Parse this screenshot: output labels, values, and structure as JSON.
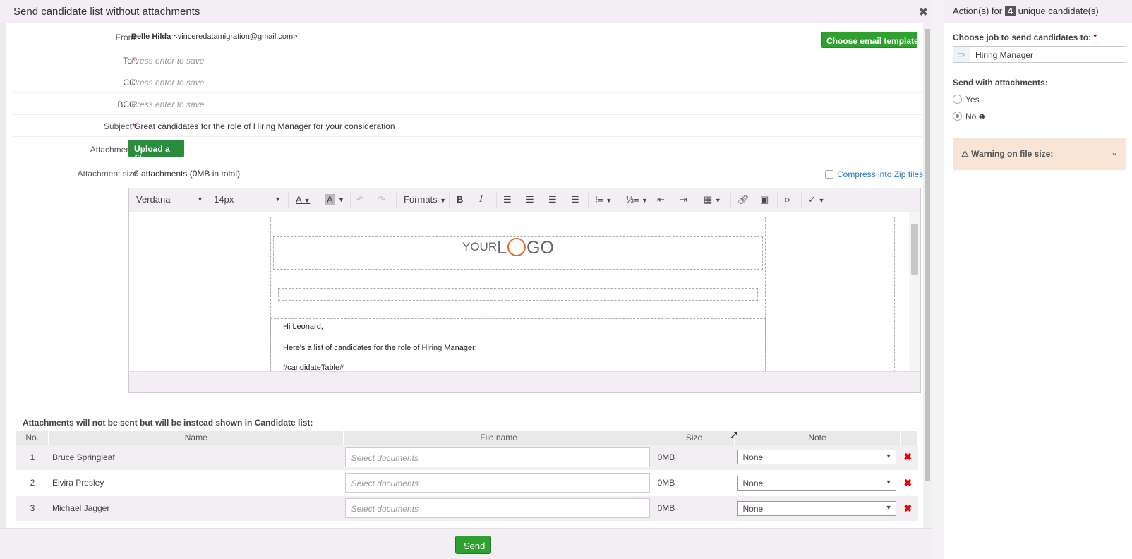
{
  "modal": {
    "title": "Send candidate list without attachments",
    "close": "✖"
  },
  "form": {
    "from_label": "From:",
    "from_name": "Belle Hilda",
    "from_email": "<vinceredatamigration@gmail.com>",
    "to_label": "To",
    "to_placeholder": "Press enter to save",
    "cc_label": "CC:",
    "cc_placeholder": "Press enter to save",
    "bcc_label": "BCC:",
    "bcc_placeholder": "Press enter to save",
    "subject_label": "Subject",
    "subject_value": "Great candidates for the role of Hiring Manager for your consideration",
    "attachment_label": "Attachment :",
    "upload_label": "Upload a file",
    "attachment_size_label": "Attachment size",
    "attachment_size_value": "0 attachments (0MB in total)",
    "compress_label": "Compress into Zip files",
    "template_button": "Choose email template ▾",
    "required_mark": "*",
    "colon": ":"
  },
  "editor": {
    "font": "Verdana",
    "size": "14px",
    "formats": "Formats",
    "icons": [
      "font-color-icon",
      "highlight-icon",
      "undo-icon",
      "redo-icon",
      "bold-icon",
      "italic-icon",
      "align-left-icon",
      "align-center-icon",
      "align-right-icon",
      "justify-icon",
      "bullet-list-icon",
      "numbered-list-icon",
      "outdent-icon",
      "indent-icon",
      "table-icon",
      "link-icon",
      "image-icon",
      "code-icon",
      "spellcheck-icon"
    ],
    "logo_your": "YOUR",
    "logo_l": "L",
    "logo_go": "GO",
    "greeting": "Hi Leonard,",
    "body_line": "Here's a list of candidates for the role of Hiring Manager:",
    "placeholder_tag": "#candidateTable#"
  },
  "attachments_note": "Attachments will not be sent but will be instead shown in Candidate list:",
  "table": {
    "headers": {
      "no": "No.",
      "name": "Name",
      "file": "File name",
      "size": "Size",
      "note": "Note"
    },
    "rows": [
      {
        "no": "1",
        "name": "Bruce Springleaf",
        "file_placeholder": "Select documents",
        "size": "0MB",
        "note": "None"
      },
      {
        "no": "2",
        "name": "Elvira Presley",
        "file_placeholder": "Select documents",
        "size": "0MB",
        "note": "None"
      },
      {
        "no": "3",
        "name": "Michael Jagger",
        "file_placeholder": "Select documents",
        "size": "0MB",
        "note": "None"
      }
    ]
  },
  "send_button": "Send",
  "panel": {
    "title_prefix": "Action(s) for",
    "count": "4",
    "title_suffix": "unique candidate(s)",
    "job_label": "Choose job to send candidates to:",
    "job_value": "Hiring Manager",
    "attachments_label": "Send with attachments:",
    "yes": "Yes",
    "no": "No",
    "warning": "Warning on file size:"
  },
  "colors": {
    "green": "#2fa12f",
    "link": "#2c7bbf",
    "warning_bg": "#f9e5d6",
    "header_bg": "#f3eef4",
    "logo_accent": "#e86a2e"
  }
}
